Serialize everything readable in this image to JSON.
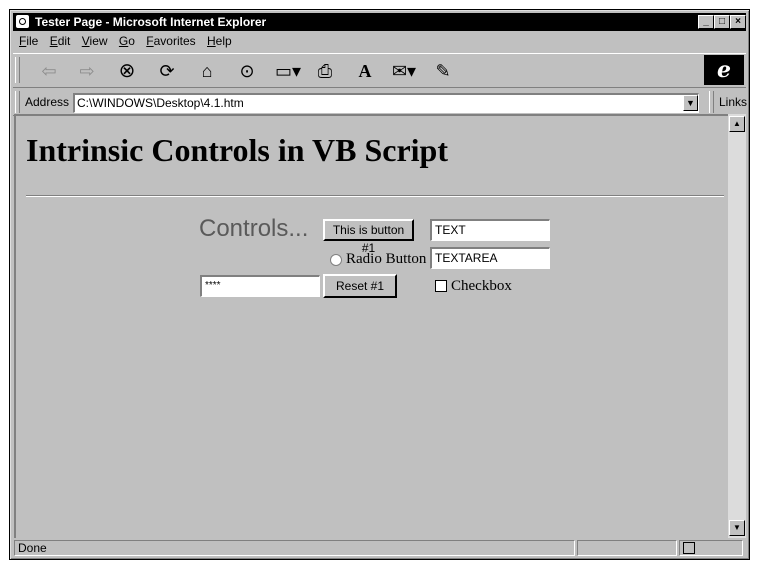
{
  "window": {
    "title": "Tester Page - Microsoft Internet Explorer"
  },
  "menu": {
    "items": [
      "File",
      "Edit",
      "View",
      "Go",
      "Favorites",
      "Help"
    ]
  },
  "toolbar": {
    "icons": [
      "back-icon",
      "forward-icon",
      "stop-icon",
      "refresh-icon",
      "home-icon",
      "search-icon",
      "favorites-icon",
      "print-icon",
      "font-icon",
      "mail-icon",
      "edit-icon"
    ]
  },
  "address": {
    "label": "Address",
    "value": "C:\\WINDOWS\\Desktop\\4.1.htm",
    "links_label": "Links"
  },
  "page": {
    "heading": "Intrinsic Controls in VB Script",
    "controls_label": "Controls...",
    "button1_label": "This is button #1",
    "text_value": "TEXT",
    "radio_label": "Radio Button",
    "textarea_value": "TEXTAREA",
    "password_value": "****",
    "reset_label": "Reset #1",
    "checkbox_label": "Checkbox"
  },
  "status": {
    "text": "Done"
  }
}
